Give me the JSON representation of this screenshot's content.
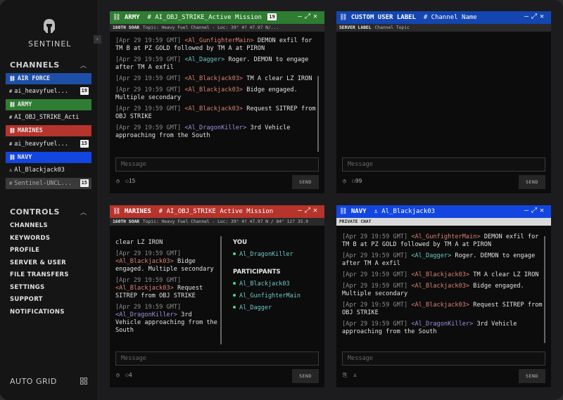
{
  "sidebar": {
    "brand": "SENTINEL",
    "channels_title": "CHANNELS",
    "channels": [
      {
        "label": "AIR FORCE",
        "type": "header",
        "color": "#1d4fa8"
      },
      {
        "label": "ai_heavyfuel...",
        "type": "channel",
        "badge": "19"
      },
      {
        "label": "ARMY",
        "type": "header",
        "color": "#2e7d32"
      },
      {
        "label": "AI_OBJ_STRIKE_Acti",
        "type": "channel"
      },
      {
        "label": "MARINES",
        "type": "header",
        "color": "#b5342c"
      },
      {
        "label": "ai_heavyfuel...",
        "type": "channel",
        "badge": "15"
      },
      {
        "label": "NAVY",
        "type": "header",
        "color": "#1346e0"
      },
      {
        "label": "Al_Blackjack03",
        "type": "user"
      },
      {
        "label": "Sentinel-UNCL...",
        "type": "channel",
        "badge": "15"
      }
    ],
    "controls_title": "CONTROLS",
    "controls": [
      "CHANNELS",
      "KEYWORDS",
      "PROFILE",
      "SERVER & USER",
      "FILE TRANSFERS",
      "SETTINGS",
      "SUPPORT",
      "NOTIFICATIONS"
    ],
    "auto_grid": "AUTO GRID"
  },
  "panels": {
    "army": {
      "group": "ARMY",
      "channel": "AI_OBJ_STRIKE_Active Mission",
      "badge": "19",
      "color": "#2e7d32",
      "sub_bold": "160TH SOAR",
      "sub": "Topic: Heavy Fuel Channel - Loc: 39° 4? 47.97 N/...",
      "messages": [
        {
          "ts": "[Apr 29 19:59 GMT]",
          "user": "<Al_GunfighterMain>",
          "text": " DEMON exfil for TM B at PZ GOLD followed by TM A at PIRON",
          "color": "#d98070"
        },
        {
          "ts": "[Apr 29 19:59 GMT]",
          "user": "<Al_Dagger>",
          "text": " Roger. DEMON to engage after TM A exfil",
          "color": "#6ec6c6"
        },
        {
          "ts": "[Apr 29 19:59 GMT]",
          "user": "<Al_Blackjack03>",
          "text": " TM A clear LZ IRON",
          "color": "#d98070"
        },
        {
          "ts": "[Apr 29 19:59 GMT]",
          "user": "<Al_Blackjack03>",
          "text": " Bidge engaged. Multiple secondary",
          "color": "#d98070"
        },
        {
          "ts": "[Apr 29 19:59 GMT]",
          "user": "<Al_Blackjack03>",
          "text": " Request SITREP from OBJ STRIKE",
          "color": "#d98070"
        },
        {
          "ts": "[Apr 29 19:59 GMT]",
          "user": "<Al_DragonKiller>",
          "text": " 3rd Vehicle approaching from the South",
          "color": "#9b8fe0"
        }
      ],
      "placeholder": "Message",
      "send": "SEND",
      "users": "15"
    },
    "custom": {
      "group": "CUSTOM USER LABEL",
      "channel": "Channel Name",
      "color": "#1346b0",
      "sub_bold": "SERVER LABEL",
      "sub": "Channel Topic",
      "placeholder": "Message",
      "send": "SEND",
      "users": "99"
    },
    "marines": {
      "group": "MARINES",
      "channel": "AI_OBJ_STRIKE Active Mission",
      "color": "#b5342c",
      "sub_bold": "160TH SOAR",
      "sub": "Topic: Heavy Fuel Channel - Loc: 39° 4? 47.97 N / 84° 12? 35.9",
      "messages": [
        {
          "ts": "",
          "user": "",
          "text": "clear LZ IRON",
          "color": "#d98070"
        },
        {
          "ts": "[Apr 29 19:59 GMT]",
          "user": "<Al_Blackjack03>",
          "text": " Bidge engaged. Multiple secondary",
          "color": "#d98070"
        },
        {
          "ts": "[Apr 29 19:59 GMT]",
          "user": "<Al_Blackjack03>",
          "text": " Request SITREP from OBJ STRIKE",
          "color": "#d98070"
        },
        {
          "ts": "[Apr 29 19:59 GMT]",
          "user": "<Al_DragonKiller>",
          "text": " 3rd Vehicle approaching from the South",
          "color": "#9b8fe0"
        }
      ],
      "you_title": "YOU",
      "you": "Al_DragonKiller",
      "participants_title": "PARTICIPANTS",
      "participants": [
        "Al_Blackjack03",
        "Al_GunfighterMain",
        "Al_Dagger"
      ],
      "placeholder": "Message",
      "send": "SEND",
      "users": "4"
    },
    "navy": {
      "group": "NAVY",
      "channel": "Al_Blackjack03",
      "color": "#1346e0",
      "sub_bold": "PRIVATE CHAT",
      "messages": [
        {
          "ts": "[Apr 29 19:59 GMT]",
          "user": "<Al_GunfighterMain>",
          "text": " DEMON exfil for TM B at PZ GOLD followed by TM A at PIRON",
          "color": "#d98070"
        },
        {
          "ts": "[Apr 29 19:59 GMT]",
          "user": "<Al_Dagger>",
          "text": " Roger. DEMON to engage after TM A exfil",
          "color": "#6ec6c6"
        },
        {
          "ts": "[Apr 29 19:59 GMT]",
          "user": "<Al_Blackjack03>",
          "text": " TM A clear LZ IRON",
          "color": "#d98070"
        },
        {
          "ts": "[Apr 29 19:59 GMT]",
          "user": "<Al_Blackjack03>",
          "text": " Bidge engaged. Multiple secondary",
          "color": "#d98070"
        },
        {
          "ts": "[Apr 29 19:59 GMT]",
          "user": "<Al_Blackjack03>",
          "text": " Request SITREP from OBJ STRIKE",
          "color": "#d98070"
        },
        {
          "ts": "[Apr 29 19:59 GMT]",
          "user": "<Al_DragonKiller>",
          "text": " 3rd Vehicle approaching from the South",
          "color": "#9b8fe0"
        }
      ],
      "placeholder": "Message",
      "send": "SEND"
    }
  }
}
